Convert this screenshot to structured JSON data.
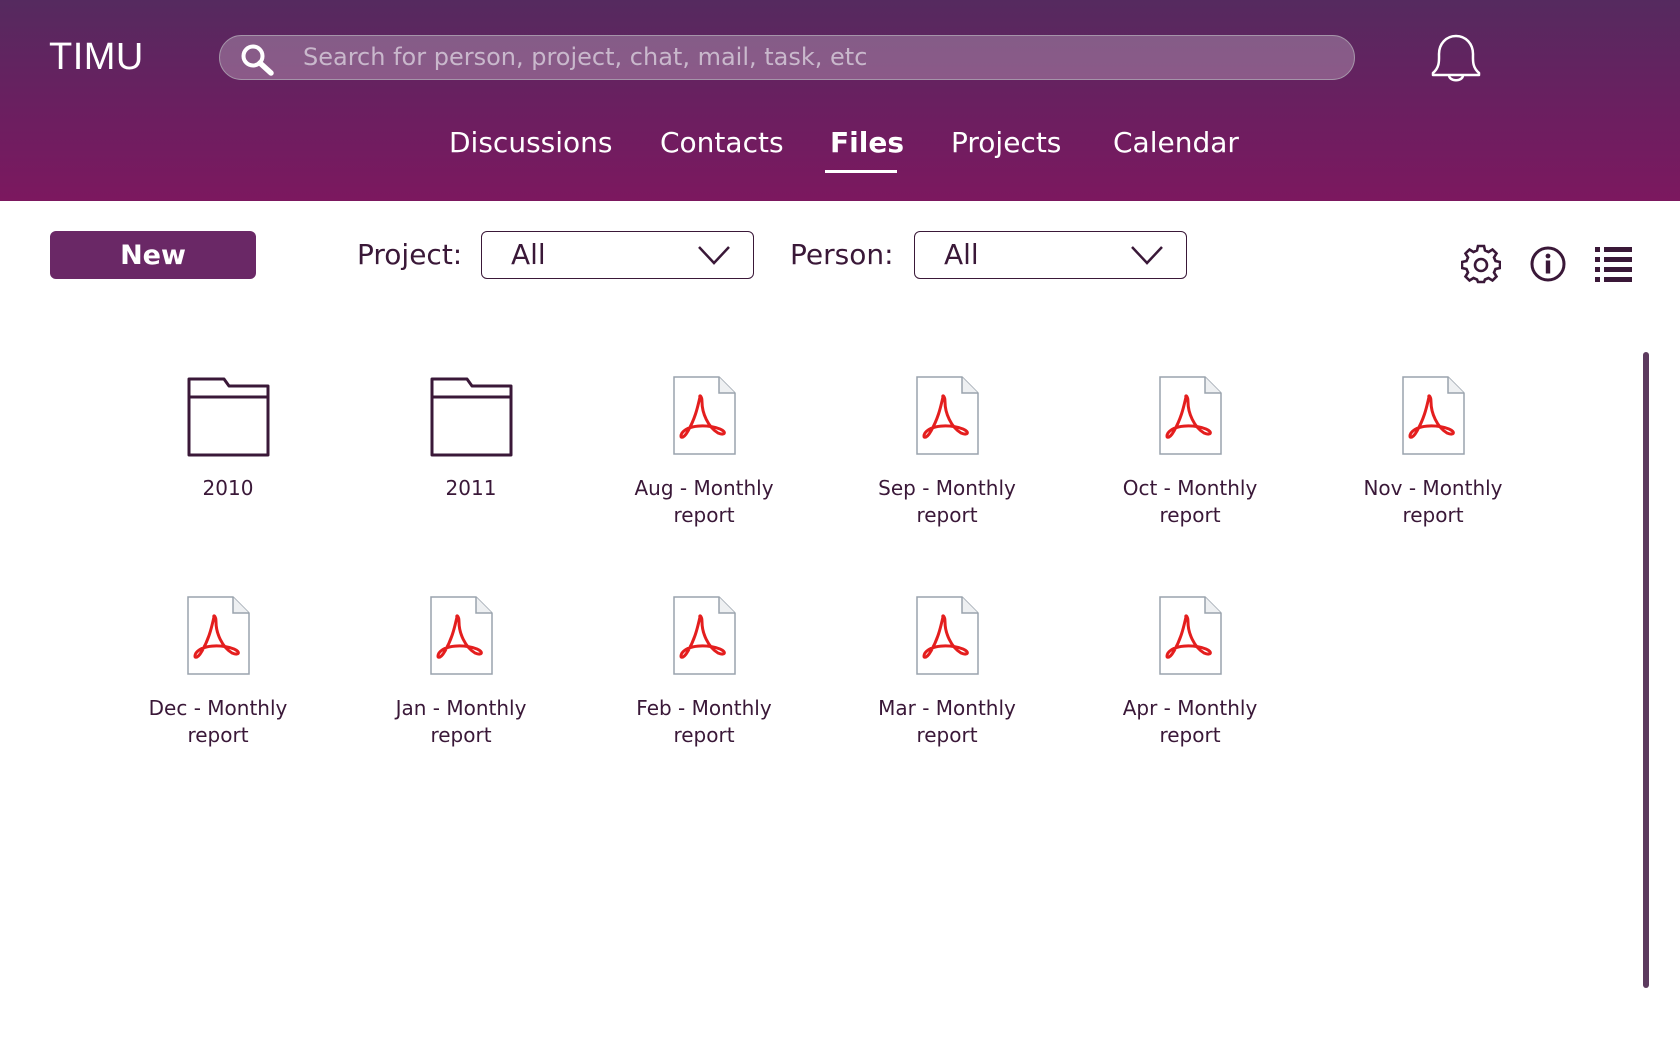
{
  "app": {
    "logo": "TIMU"
  },
  "search": {
    "placeholder": "Search for person, project, chat, mail, task, etc",
    "value": ""
  },
  "nav": {
    "items": [
      {
        "label": "Discussions",
        "active": false
      },
      {
        "label": "Contacts",
        "active": false
      },
      {
        "label": "Files",
        "active": true
      },
      {
        "label": "Projects",
        "active": false
      },
      {
        "label": "Calendar",
        "active": false
      }
    ]
  },
  "toolbar": {
    "new_label": "New",
    "project_label": "Project:",
    "project_value": "All",
    "person_label": "Person:",
    "person_value": "All"
  },
  "icons": {
    "search": "search-icon",
    "bell": "bell-icon",
    "settings": "gear-icon",
    "info": "info-icon",
    "list": "list-view-icon",
    "folder": "folder-icon",
    "pdf": "pdf-file-icon"
  },
  "colors": {
    "header_top": "#552a5f",
    "header_bottom": "#7c185f",
    "accent": "#6a2866",
    "text": "#3a1838",
    "pdf_red": "#e41e1e"
  },
  "files": [
    {
      "type": "folder",
      "label": "2010"
    },
    {
      "type": "folder",
      "label": "2011"
    },
    {
      "type": "pdf",
      "label": "Aug - Monthly\nreport"
    },
    {
      "type": "pdf",
      "label": "Sep - Monthly\nreport"
    },
    {
      "type": "pdf",
      "label": "Oct - Monthly\nreport"
    },
    {
      "type": "pdf",
      "label": "Nov - Monthly\nreport"
    },
    {
      "type": "pdf",
      "label": "Dec - Monthly\nreport"
    },
    {
      "type": "pdf",
      "label": "Jan - Monthly\nreport"
    },
    {
      "type": "pdf",
      "label": "Feb - Monthly\nreport"
    },
    {
      "type": "pdf",
      "label": "Mar - Monthly\nreport"
    },
    {
      "type": "pdf",
      "label": "Apr - Monthly\nreport"
    }
  ]
}
